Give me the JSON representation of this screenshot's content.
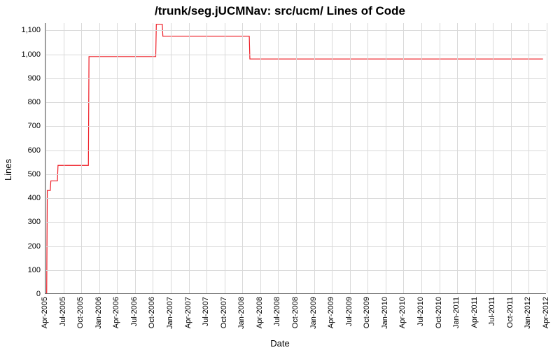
{
  "chart_data": {
    "type": "line",
    "title": "/trunk/seg.jUCMNav: src/ucm/ Lines of Code",
    "xlabel": "Date",
    "ylabel": "Lines",
    "ylim": [
      0,
      1130
    ],
    "y_ticks": [
      0,
      100,
      200,
      300,
      400,
      500,
      600,
      700,
      800,
      900,
      1000,
      1100
    ],
    "x_ticks": [
      "Apr-2005",
      "Jul-2005",
      "Oct-2005",
      "Jan-2006",
      "Apr-2006",
      "Jul-2006",
      "Oct-2006",
      "Jan-2007",
      "Apr-2007",
      "Jul-2007",
      "Oct-2007",
      "Jan-2008",
      "Apr-2008",
      "Jul-2008",
      "Oct-2008",
      "Jan-2009",
      "Apr-2009",
      "Jul-2009",
      "Oct-2009",
      "Jan-2010",
      "Apr-2010",
      "Jul-2010",
      "Oct-2010",
      "Jan-2011",
      "Apr-2011",
      "Jul-2011",
      "Oct-2011",
      "Jan-2012",
      "Apr-2012"
    ],
    "x_range_months": [
      0,
      84
    ],
    "series": [
      {
        "name": "Lines of Code",
        "color": "#ee1c25",
        "points": [
          {
            "x_month": 0.2,
            "y": 0
          },
          {
            "x_month": 0.3,
            "y": 430
          },
          {
            "x_month": 0.8,
            "y": 430
          },
          {
            "x_month": 0.9,
            "y": 470
          },
          {
            "x_month": 2.0,
            "y": 470
          },
          {
            "x_month": 2.1,
            "y": 535
          },
          {
            "x_month": 7.2,
            "y": 535
          },
          {
            "x_month": 7.3,
            "y": 990
          },
          {
            "x_month": 18.5,
            "y": 990
          },
          {
            "x_month": 18.6,
            "y": 1125
          },
          {
            "x_month": 19.6,
            "y": 1125
          },
          {
            "x_month": 19.7,
            "y": 1075
          },
          {
            "x_month": 34.2,
            "y": 1075
          },
          {
            "x_month": 34.3,
            "y": 980
          },
          {
            "x_month": 83.5,
            "y": 980
          }
        ]
      }
    ]
  }
}
